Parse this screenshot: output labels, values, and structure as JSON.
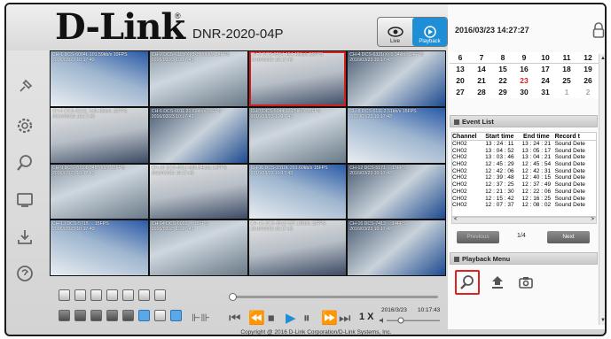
{
  "brand": {
    "logo": "D-Link",
    "reg": "®",
    "model": "DNR-2020-04P"
  },
  "mode": {
    "live_label": "Live",
    "playback_label": "Playback"
  },
  "datetime": "2016/03/23 14:27:27",
  "cameras": [
    {
      "line1": "CH-1 DCS-6004L 101.59kb/s 10FPS",
      "line2": "2016/03/23 10:17:43"
    },
    {
      "line1": "CH-2 DCS-6115(X) 3x3 00kb/s 14FPS",
      "line2": "2016/03/23 10:17:43"
    },
    {
      "line1": "CH-3 DCS-6314 464.42kb/s 15FPS",
      "line2": "2016/03/23 10:17:43"
    },
    {
      "line1": "CH-4 DCS-6321(X) 5.34kb/s 14FPS",
      "line2": "2016/03/23 10:17:43"
    },
    {
      "line1": "CH-5 DCS-5211L 548.43kb/s 15FPS",
      "line2": "2016/03/23 10:17:43"
    },
    {
      "line1": "CH-6 DCS-6011 21.69kb/s 15FPS",
      "line2": "2016/03/23 10:17:43"
    },
    {
      "line1": "CH-7 DCS-6044 12.25kb/s 15FPS",
      "line2": "2016/03/23 10:17:43"
    },
    {
      "line1": "CH-8 DCS-6111 2.51kb/s 15FPS",
      "line2": "2016/03/23 10:17:43"
    },
    {
      "line1": "CH-9 DCS-7010L 848.7kb/s 15FPS",
      "line2": "2016/03/23 10:17:43"
    },
    {
      "line1": "CH-10 DCS-6314 638.34kb/s 14FPS",
      "line2": "2016/03/23 10:17:43"
    },
    {
      "line1": "CH-11 DCS-2310L 201.60kb/s 15FPS",
      "line2": "2016/03/23 10:17:43"
    },
    {
      "line1": "CH-12 DCS-5171 ... 15FPS",
      "line2": "2016/03/23 10:17:43"
    },
    {
      "line1": "CH-13 DCS-5715 ... 15FPS",
      "line2": "2016/03/23 10:17:43"
    },
    {
      "line1": "CH-14 DCS-6022 ... 15FPS",
      "line2": "2016/03/23 10:17:43"
    },
    {
      "line1": "CH-15 DCS-8513 537.19kb/s 15FPS",
      "line2": "2016/03/23 10:17:43"
    },
    {
      "line1": "CH-16 DCS-7413 ... 14FPS",
      "line2": "2016/03/23 10:17:43"
    }
  ],
  "playback": {
    "speed": "1 X",
    "date": "2016/3/23",
    "time": "10:17:43"
  },
  "footer": "Copyright @ 2016 D-Link Corporation/D-Link Systems, Inc.",
  "calendar": {
    "weeks": [
      [
        "6",
        "7",
        "8",
        "9",
        "10",
        "11",
        "12"
      ],
      [
        "13",
        "14",
        "15",
        "16",
        "17",
        "18",
        "19"
      ],
      [
        "20",
        "21",
        "22",
        "23",
        "24",
        "25",
        "26"
      ],
      [
        "27",
        "28",
        "29",
        "30",
        "31",
        "1",
        "2"
      ]
    ]
  },
  "event_list": {
    "title": "Event List",
    "headers": [
      "Channel",
      "Start time",
      "End time",
      "Record t"
    ],
    "rows": [
      [
        "CH02",
        "13 : 24 : 11",
        "13 : 24 : 21",
        "Sound Dete"
      ],
      [
        "CH02",
        "13 : 04 : 52",
        "13 : 05 : 17",
        "Sound Dete"
      ],
      [
        "CH02",
        "13 : 03 : 46",
        "13 : 04 : 21",
        "Sound Dete"
      ],
      [
        "CH02",
        "12 : 45 : 29",
        "12 : 45 : 54",
        "Sound Dete"
      ],
      [
        "CH02",
        "12 : 42 : 06",
        "12 : 42 : 31",
        "Sound Dete"
      ],
      [
        "CH02",
        "12 : 39 : 48",
        "12 : 40 : 15",
        "Sound Dete"
      ],
      [
        "CH02",
        "12 : 37 : 25",
        "12 : 37 : 49",
        "Sound Dete"
      ],
      [
        "CH02",
        "12 : 21 : 30",
        "12 : 22 : 06",
        "Sound Dete"
      ],
      [
        "CH02",
        "12 : 15 : 42",
        "12 : 16 : 25",
        "Sound Dete"
      ],
      [
        "CH02",
        "12 : 07 : 37",
        "12 : 08 : 02",
        "Sound Dete"
      ]
    ],
    "prev": "Previous",
    "page": "1/4",
    "next": "Next"
  },
  "playback_menu": {
    "title": "Playback Menu"
  }
}
